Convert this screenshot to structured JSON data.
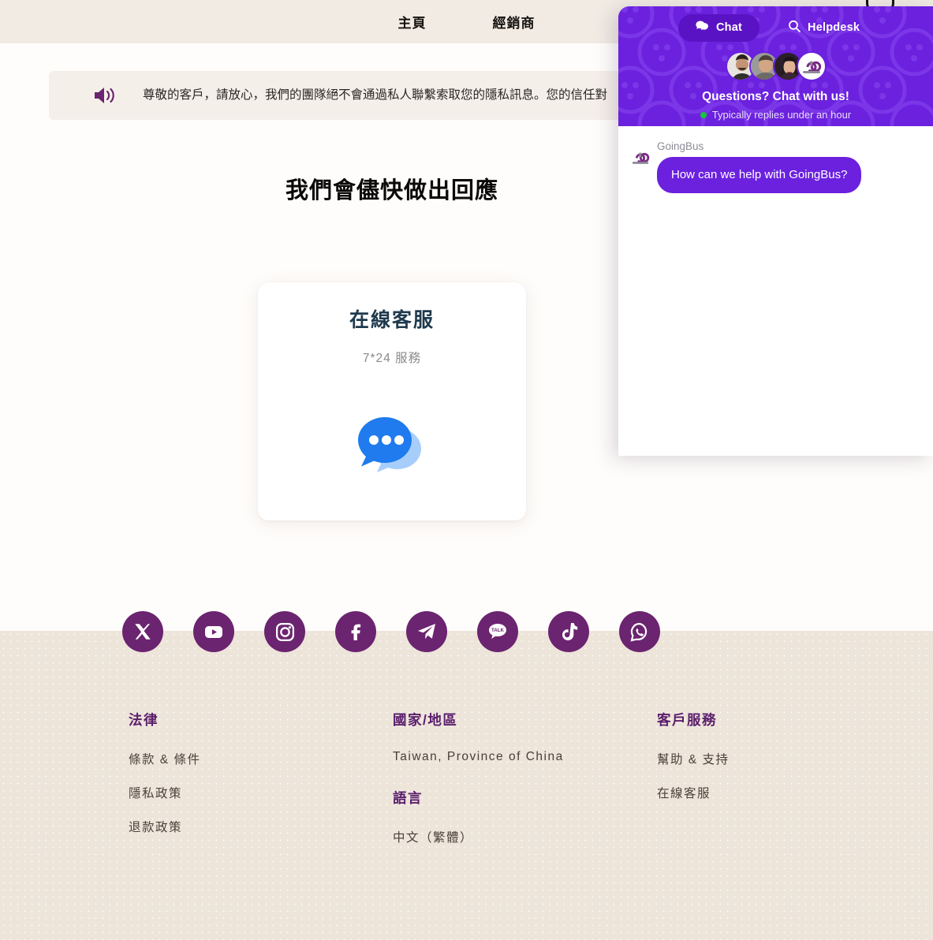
{
  "header": {
    "nav_items": [
      {
        "label": "主頁",
        "name": "nav-home"
      },
      {
        "label": "經銷商",
        "name": "nav-dealer"
      }
    ]
  },
  "notice": {
    "icon": "speaker-icon",
    "text": "尊敬的客戶，請放心，我們的團隊絕不會通過私人聯繫索取您的隱私訊息。您的信任對"
  },
  "main": {
    "heading": "我們會儘快做出回應",
    "card": {
      "title": "在線客服",
      "subtitle": "7*24 服務",
      "icon": "chat-bubbles-icon"
    }
  },
  "social": {
    "items": [
      {
        "name": "x-twitter-icon",
        "label": "X"
      },
      {
        "name": "youtube-icon",
        "label": "YouTube"
      },
      {
        "name": "instagram-icon",
        "label": "Instagram"
      },
      {
        "name": "facebook-icon",
        "label": "Facebook"
      },
      {
        "name": "telegram-icon",
        "label": "Telegram"
      },
      {
        "name": "kakaotalk-icon",
        "label": "KakaoTalk"
      },
      {
        "name": "tiktok-icon",
        "label": "TikTok"
      },
      {
        "name": "whatsapp-icon",
        "label": "WhatsApp"
      }
    ]
  },
  "footer": {
    "legal": {
      "heading": "法律",
      "links": [
        "條款 & 條件",
        "隱私政策",
        "退款政策"
      ]
    },
    "region": {
      "heading": "國家/地區",
      "value": "Taiwan, Province of China",
      "language_heading": "語言",
      "language_value": "中文（繁體）"
    },
    "support": {
      "heading": "客戶服務",
      "links": [
        "幫助 & 支持",
        "在線客服"
      ]
    }
  },
  "chat_widget": {
    "tabs": [
      {
        "label": "Chat",
        "icon": "chat-bubbles-icon",
        "active": true
      },
      {
        "label": "Helpdesk",
        "icon": "search-icon",
        "active": false
      }
    ],
    "headline": "Questions? Chat with us!",
    "status": "Typically replies under an hour",
    "message": {
      "sender": "GoingBus",
      "text": "How can we help with GoingBus?"
    },
    "brand_logo": "goingbus-logo-icon",
    "colors": {
      "header_purple": "#6B21DE",
      "active_tab_purple": "#5A13C4",
      "status_green": "#19C437"
    }
  },
  "colors": {
    "header_bg": "#F2EBE4",
    "page_bg": "#FFFDFB",
    "footer_bg": "#EDE4DA",
    "accent_purple": "#6B2470",
    "heading_purple": "#5A1E6B",
    "card_title": "#1F3A4D",
    "bubble_blue": "#1F7BEE"
  }
}
